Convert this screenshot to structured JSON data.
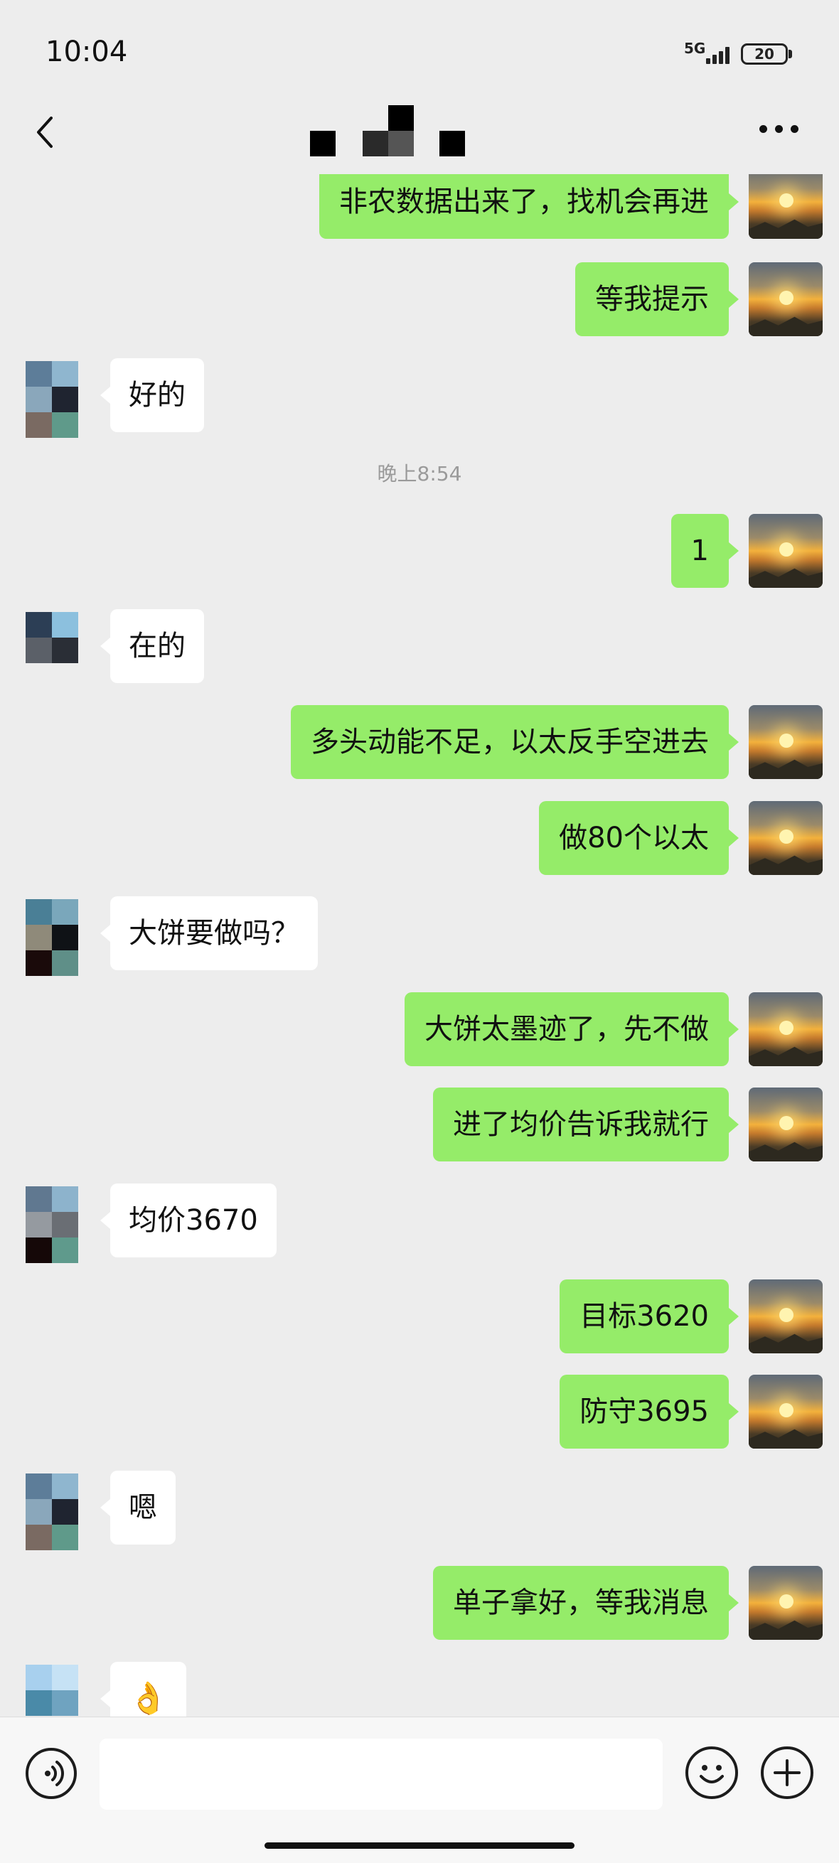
{
  "status_bar": {
    "time": "10:04",
    "network": "5G",
    "battery": "20"
  },
  "nav": {
    "back_icon": "chevron-left-icon",
    "more_icon": "more-icon"
  },
  "messages": [
    {
      "from": "me",
      "text": "非农数据出来了，找机会再进"
    },
    {
      "from": "me",
      "text": "等我提示"
    },
    {
      "from": "other",
      "text": "好的"
    },
    {
      "type": "timestamp",
      "text": "晚上8:54"
    },
    {
      "from": "me",
      "text": "1"
    },
    {
      "from": "other",
      "text": "在的"
    },
    {
      "from": "me",
      "text": "多头动能不足，以太反手空进去"
    },
    {
      "from": "me",
      "text": "做80个以太"
    },
    {
      "from": "other",
      "text": "大饼要做吗？"
    },
    {
      "from": "me",
      "text": "大饼太墨迹了，先不做"
    },
    {
      "from": "me",
      "text": "进了均价告诉我就行"
    },
    {
      "from": "other",
      "text": "均价3670"
    },
    {
      "from": "me",
      "text": "目标3620"
    },
    {
      "from": "me",
      "text": "防守3695"
    },
    {
      "from": "other",
      "text": "嗯"
    },
    {
      "from": "me",
      "text": "单子拿好，等我消息"
    },
    {
      "from": "other",
      "text": "👌"
    }
  ],
  "input_bar": {
    "voice_icon": "voice-icon",
    "emoji_icon": "emoji-icon",
    "plus_icon": "plus-icon"
  }
}
